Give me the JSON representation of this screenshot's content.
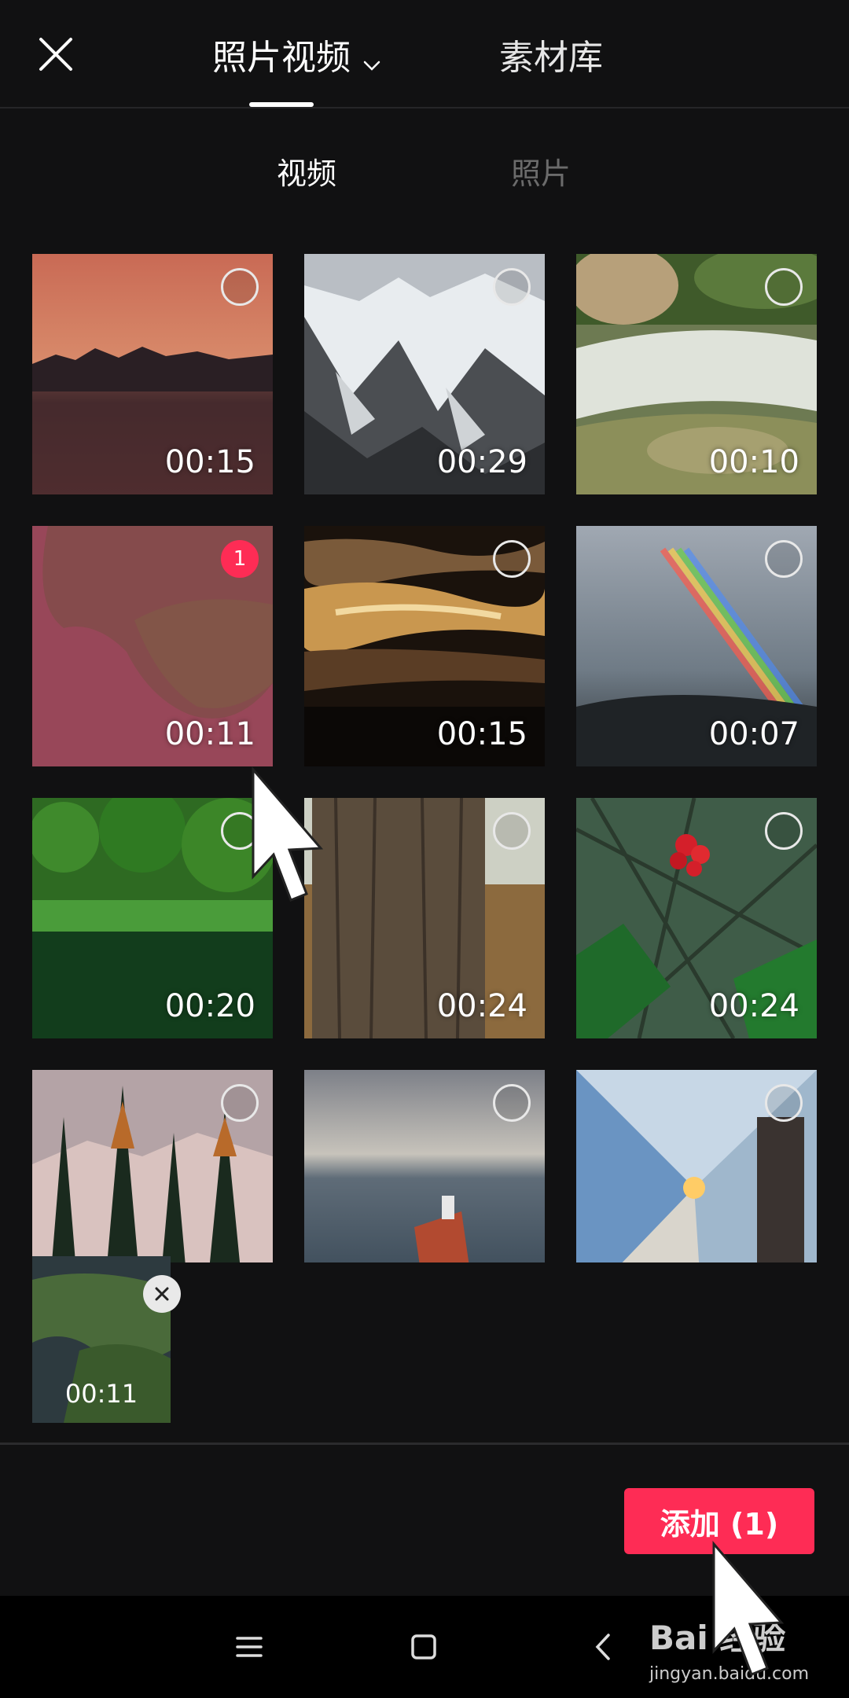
{
  "header": {
    "close_icon": "close-icon",
    "tab_media": "照片视频",
    "tab_library": "素材库"
  },
  "subtabs": {
    "video": "视频",
    "photo": "照片"
  },
  "grid": [
    {
      "duration": "00:15",
      "scene": "sunset-lake",
      "selected": false
    },
    {
      "duration": "00:29",
      "scene": "snowy-mountains",
      "selected": false
    },
    {
      "duration": "00:10",
      "scene": "stream-rocks",
      "selected": false
    },
    {
      "duration": "00:11",
      "scene": "aerial-coast",
      "selected": true,
      "order": "1"
    },
    {
      "duration": "00:15",
      "scene": "golden-water",
      "selected": false
    },
    {
      "duration": "00:07",
      "scene": "rainbow",
      "selected": false
    },
    {
      "duration": "00:20",
      "scene": "green-forest",
      "selected": false
    },
    {
      "duration": "00:24",
      "scene": "tree-trunk",
      "selected": false
    },
    {
      "duration": "00:24",
      "scene": "red-flowers",
      "selected": false
    },
    {
      "duration": "",
      "scene": "pine-trees",
      "selected": false
    },
    {
      "duration": "",
      "scene": "cargo-ship",
      "selected": false
    },
    {
      "duration": "",
      "scene": "tunnel-station",
      "selected": false
    }
  ],
  "tray": {
    "duration": "00:11",
    "remove_icon": "close-icon"
  },
  "add_button": "添加 (1)",
  "navbar": {
    "menu_icon": "menu-icon",
    "home_icon": "home-icon",
    "back_icon": "back-icon"
  },
  "watermark": {
    "top": "Bai 经验",
    "bottom": "jingyan.baidu.com"
  },
  "colors": {
    "accent": "#fe2c55",
    "background": "#111112"
  }
}
